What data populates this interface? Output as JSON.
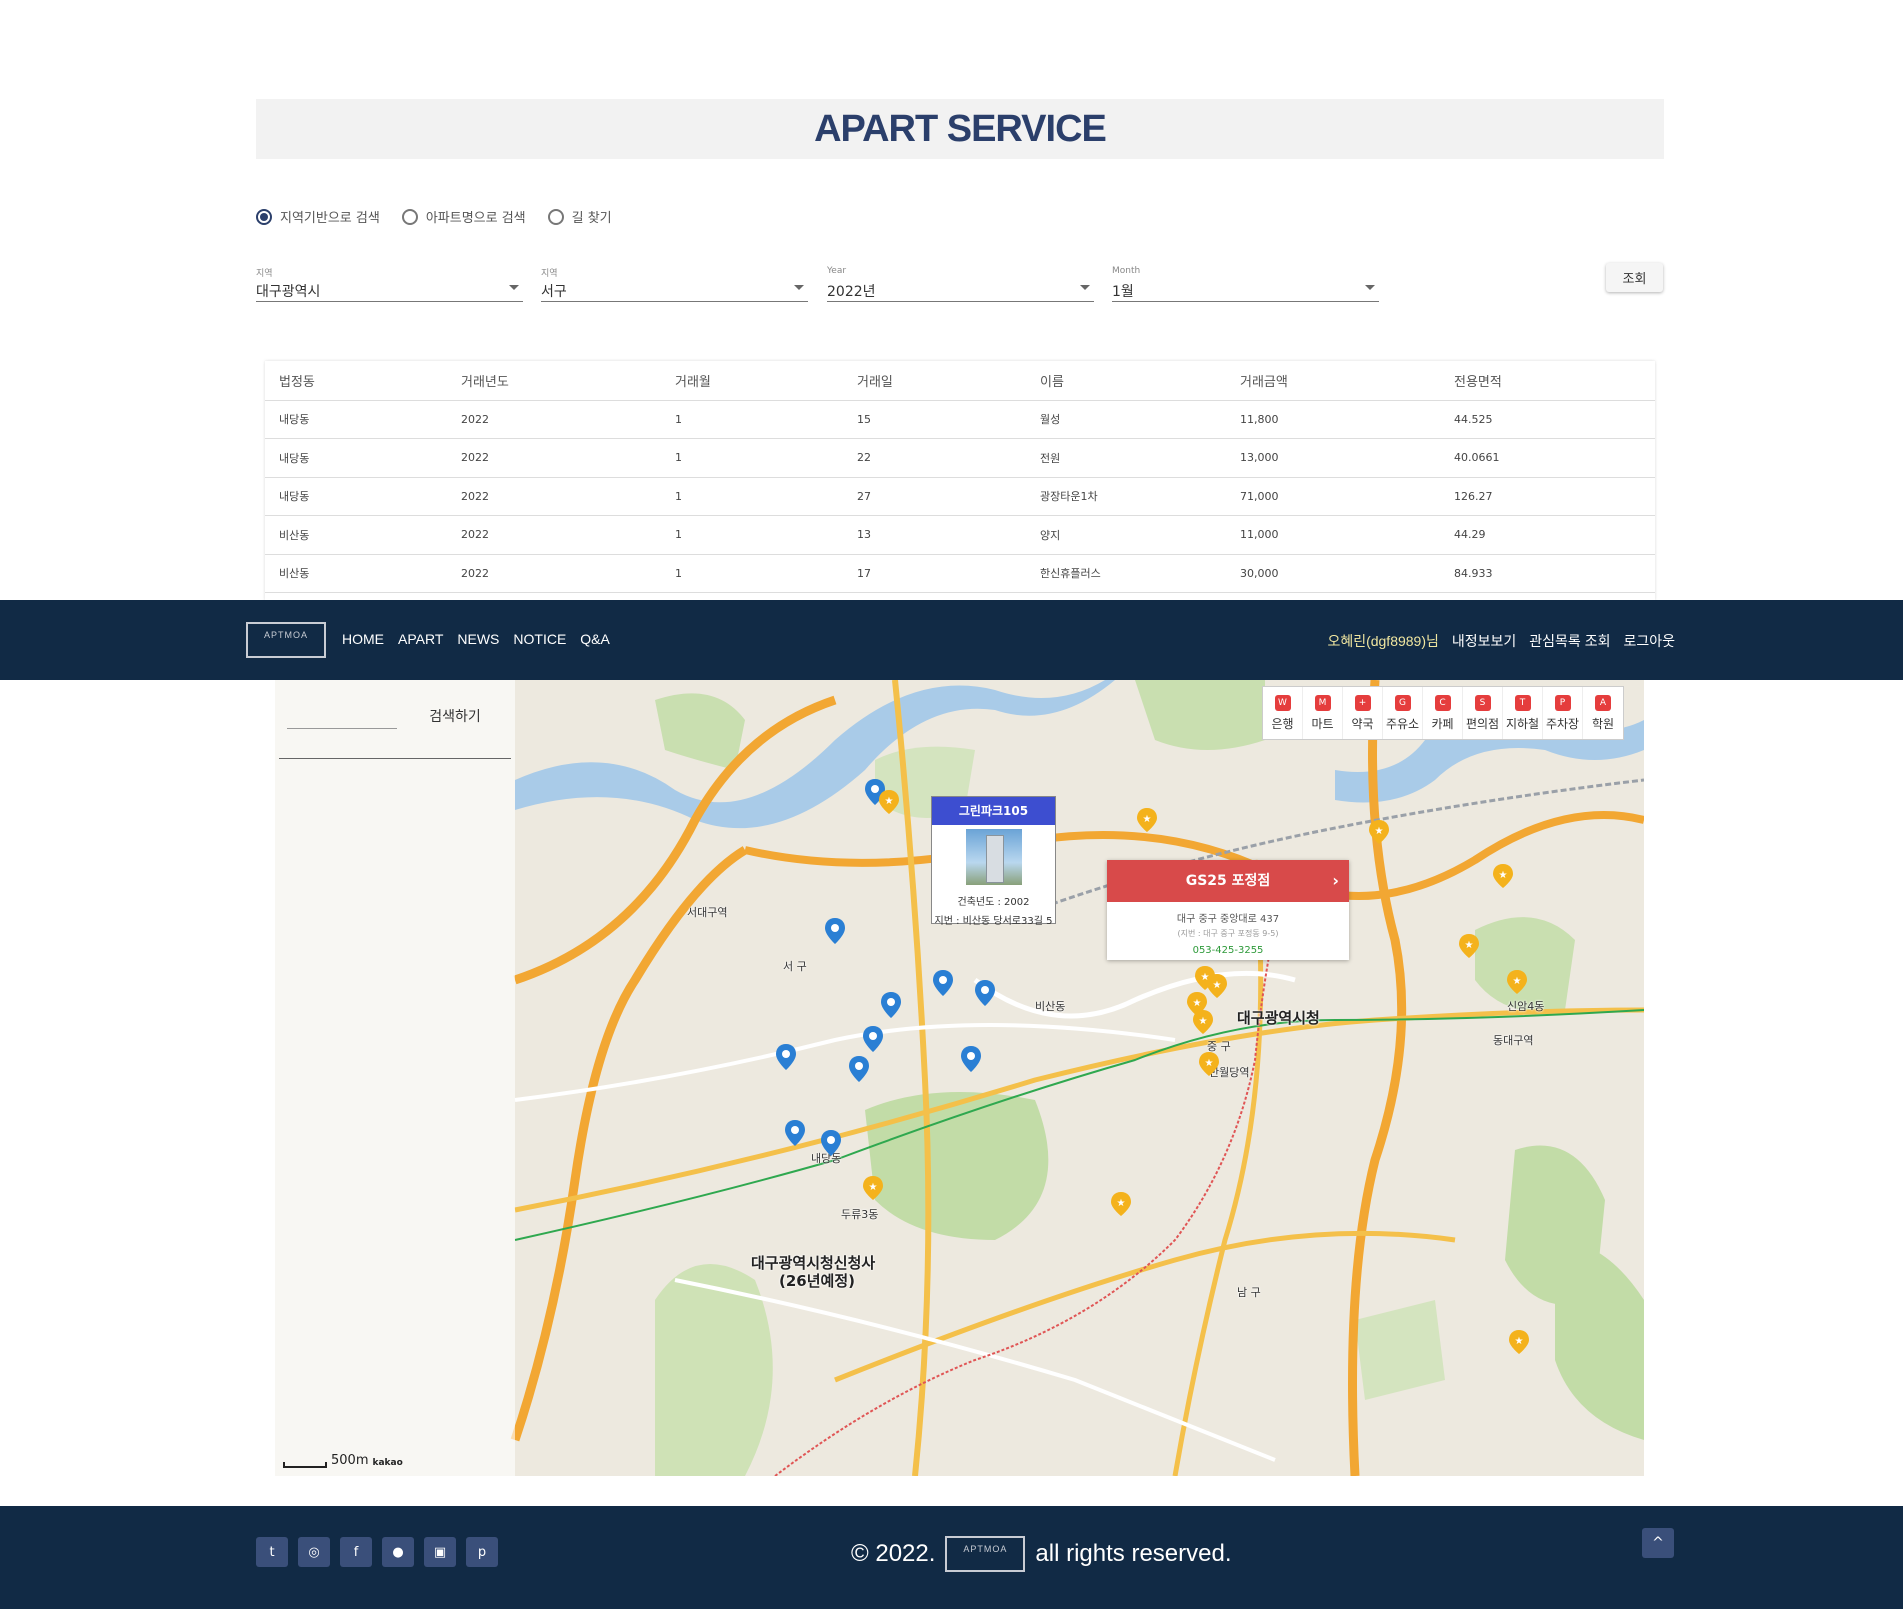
{
  "title": "APART SERVICE",
  "search_modes": [
    {
      "label": "지역기반으로 검색",
      "checked": true
    },
    {
      "label": "아파트명으로 검색",
      "checked": false
    },
    {
      "label": "길 찾기",
      "checked": false
    }
  ],
  "filters": {
    "city": {
      "label": "지역",
      "value": "대구광역시"
    },
    "district": {
      "label": "지역",
      "value": "서구"
    },
    "year": {
      "label": "Year",
      "value": "2022년"
    },
    "month": {
      "label": "Month",
      "value": "1월"
    },
    "submit": "조회"
  },
  "table": {
    "headers": [
      "법정동",
      "거래년도",
      "거래월",
      "거래일",
      "이름",
      "거래금액",
      "전용면적"
    ],
    "rows": [
      [
        "내당동",
        "2022",
        "1",
        "15",
        "월성",
        "11,800",
        "44.525"
      ],
      [
        "내당동",
        "2022",
        "1",
        "22",
        "전원",
        "13,000",
        "40.0661"
      ],
      [
        "내당동",
        "2022",
        "1",
        "27",
        "광장타운1차",
        "71,000",
        "126.27"
      ],
      [
        "비산동",
        "2022",
        "1",
        "13",
        "양지",
        "11,000",
        "44.29"
      ],
      [
        "비산동",
        "2022",
        "1",
        "17",
        "한신휴플러스",
        "30,000",
        "84.933"
      ]
    ]
  },
  "navbar": {
    "logo": "APTMOA",
    "links": [
      "HOME",
      "APART",
      "NEWS",
      "NOTICE",
      "Q&A"
    ],
    "user": "오혜린(dgf8989)님",
    "right_links": [
      "내정보보기",
      "관심목록 조회",
      "로그아웃"
    ]
  },
  "map": {
    "search_button": "검색하기",
    "categories": [
      "은행",
      "마트",
      "약국",
      "주유소",
      "카페",
      "편의점",
      "지하철",
      "주차장",
      "학원"
    ],
    "apt_info": {
      "name": "그린파크105",
      "built": "건축년도 : 2002",
      "address": "지번 : 비산동 당서로33길 5"
    },
    "store_info": {
      "name": "GS25 포정점",
      "address": "대구 중구 중앙대로 437",
      "jibun": "(지번 : 대구 중구 포정동 9-5)",
      "phone": "053-425-3255"
    },
    "labels": {
      "city_hall": "대구광역시청",
      "new_city_hall": "대구광역시청신청사",
      "new_city_hall_sub": "(26년예정)",
      "seogu": "서 구",
      "junggu": "중 구",
      "namgu": "남 구",
      "bisan": "비산동",
      "naedang": "내당동",
      "seodaegu": "서대구역",
      "banwoldang": "반월당역",
      "dongdaegu": "동대구역",
      "duryu": "두류3동",
      "sinam": "신암4동"
    },
    "scale": "500m",
    "provider": "kakao"
  },
  "footer": {
    "social": [
      "twitter-icon",
      "instagram-icon",
      "facebook-icon",
      "reddit-icon",
      "discord-icon",
      "pinterest-icon"
    ],
    "copyright_prefix": "© 2022.",
    "logo": "APTMOA",
    "copyright_suffix": "all rights reserved.",
    "to_top": "^"
  }
}
